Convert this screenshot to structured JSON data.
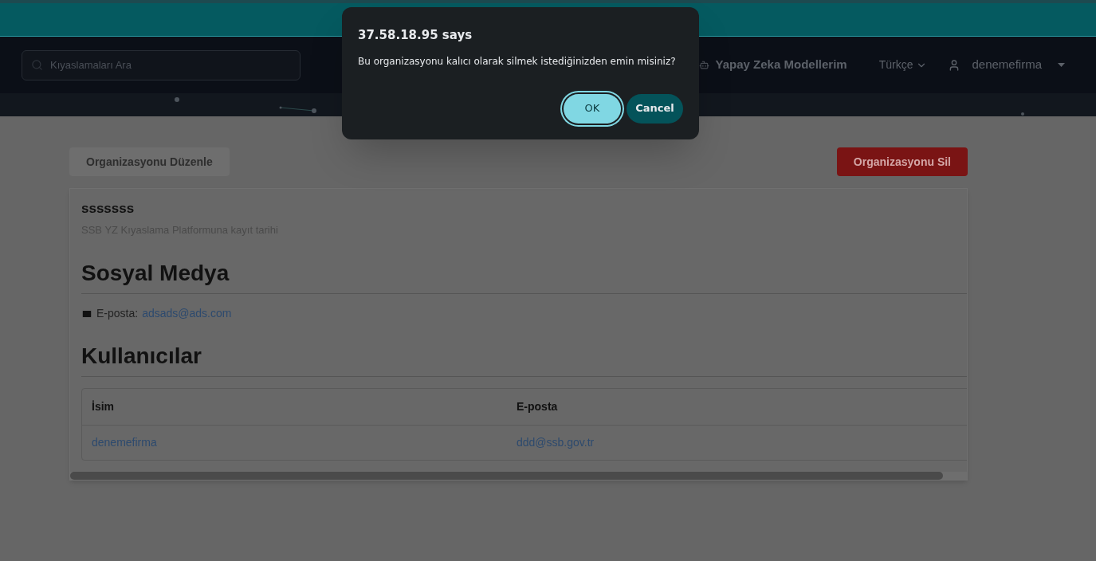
{
  "navbar": {
    "search": {
      "placeholder": "Kıyaslamaları Ara"
    },
    "models_link": "Yapay Zeka Modellerim",
    "language": "Türkçe",
    "user": "denemefirma"
  },
  "actions": {
    "edit": "Organizasyonu Düzenle",
    "delete": "Organizasyonu Sil"
  },
  "organization": {
    "name": "sssssss",
    "subtitle": "SSB YZ Kıyaslama Platformuna kayıt tarihi"
  },
  "social": {
    "heading": "Sosyal Medya",
    "email_label": "E-posta:",
    "email": "adsads@ads.com"
  },
  "users": {
    "heading": "Kullanıcılar",
    "columns": [
      "İsim",
      "E-posta"
    ],
    "rows": [
      [
        "denemefirma",
        "ddd@ssb.gov.tr"
      ]
    ]
  },
  "dialog": {
    "title": "37.58.18.95 says",
    "message": "Bu organizasyonu kalıcı olarak silmek istediğinizden emin misiniz?",
    "buttons": [
      {
        "label": "OK",
        "kind": "primary"
      },
      {
        "label": "Cancel",
        "kind": "secondary"
      }
    ]
  }
}
